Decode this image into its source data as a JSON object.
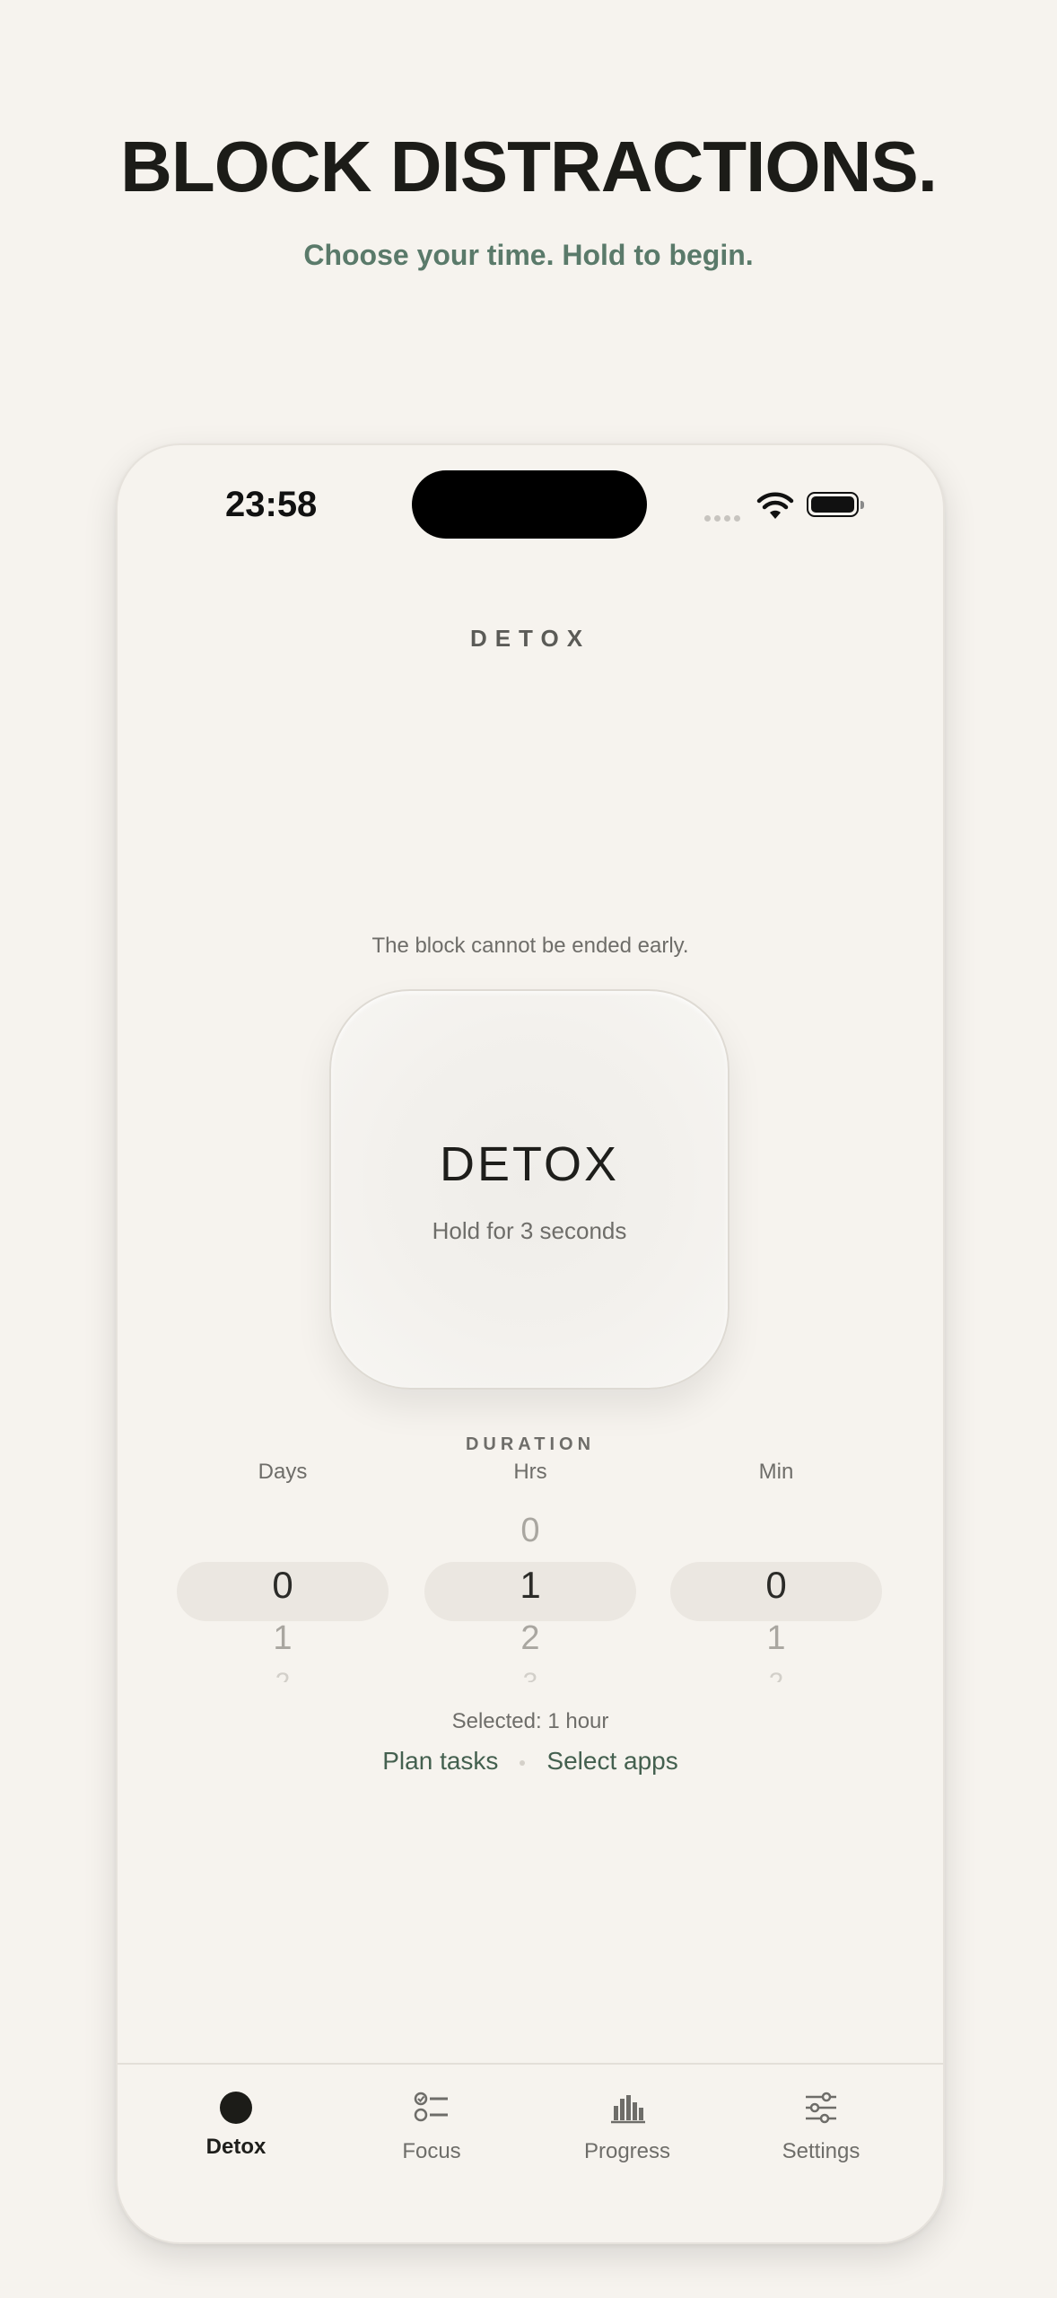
{
  "headline": "BLOCK DISTRACTIONS.",
  "subheadline": "Choose your time. Hold to begin.",
  "status_bar": {
    "time": "23:58"
  },
  "nav_title": "DETOX",
  "notice": "The block cannot be ended early.",
  "hold_button": {
    "label": "DETOX",
    "hint": "Hold for 3 seconds"
  },
  "duration": {
    "label": "DURATION",
    "columns": [
      {
        "label": "Days",
        "above": "",
        "selected": "0",
        "below": "1",
        "next": "2"
      },
      {
        "label": "Hrs",
        "above": "0",
        "selected": "1",
        "below": "2",
        "next": "3"
      },
      {
        "label": "Min",
        "above": "",
        "selected": "0",
        "below": "1",
        "next": "2"
      }
    ]
  },
  "selected_text": "Selected: 1 hour",
  "links": {
    "plan": "Plan tasks",
    "apps": "Select apps"
  },
  "tabs": [
    {
      "label": "Detox",
      "icon": "circle-icon"
    },
    {
      "label": "Focus",
      "icon": "checklist-icon"
    },
    {
      "label": "Progress",
      "icon": "bar-chart-icon"
    },
    {
      "label": "Settings",
      "icon": "sliders-icon"
    }
  ],
  "colors": {
    "accent": "#5a7a6a",
    "background": "#f6f3ee",
    "text": "#1c1c18"
  }
}
